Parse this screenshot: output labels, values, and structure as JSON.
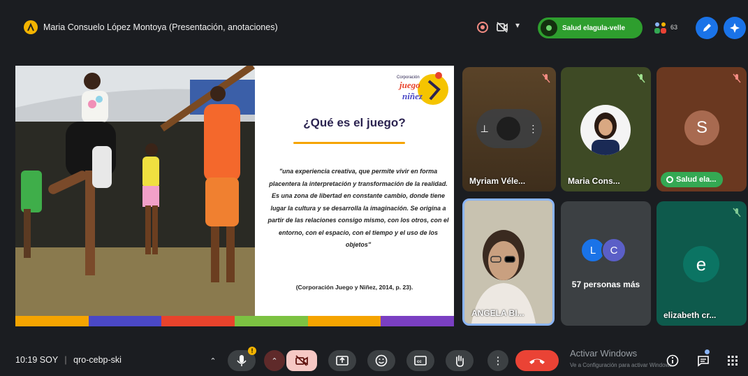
{
  "topbar": {
    "presenter_title": "Maria Consuelo López Montoya (Presentación, anotaciones)",
    "pill_label": "Salud elagula-velle",
    "participant_count": "63"
  },
  "slide": {
    "logo_small": "Corporación",
    "logo_line1": "juego",
    "logo_line2": "niñez",
    "title": "¿Qué es el juego?",
    "quote": "\"una experiencia creativa, que permite vivir en forma placentera la interpretación y transformación de la realidad. Es una zona de libertad en constante cambio, donde tiene lugar la cultura y se desarrolla la imaginación. Se origina a partir de las relaciones consigo mismo, con los otros, con el entorno, con el espacio, con el tiempo y el uso de los objetos\"",
    "citation": "(Corporación Juego y Niñez, 2014, p. 23).",
    "strip_colors": [
      "#f5a400",
      "#4a48c6",
      "#e8432c",
      "#7cc242",
      "#f5a400",
      "#7a3fc2"
    ]
  },
  "tiles": {
    "myriam": {
      "name": "Myriam Véle..."
    },
    "maria": {
      "name": "Maria Cons..."
    },
    "s_tile": {
      "initial": "S",
      "pill_label": "Salud ela..."
    },
    "angela": {
      "name": "ANGELA BI..."
    },
    "more": {
      "avatar1": "L",
      "avatar2": "C",
      "label": "57 personas más"
    },
    "elizabeth": {
      "initial": "e",
      "name": "elizabeth cr..."
    }
  },
  "bottombar": {
    "time": "10:19 SOY",
    "meeting_code": "qro-cebp-ski",
    "activate_title": "Activar Windows",
    "activate_sub": "Ve a Configuración para activar Windows."
  },
  "colors": {
    "accent_blue": "#1a73e8",
    "end_call_red": "#ea4335",
    "camera_off_bg": "#f6c8c4",
    "group_green": "#34a853"
  }
}
